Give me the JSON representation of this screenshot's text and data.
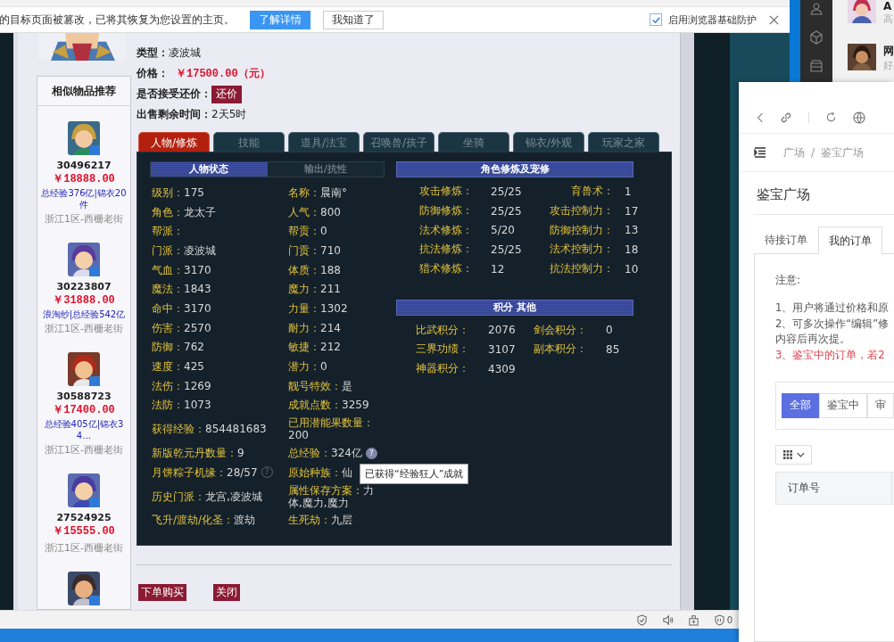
{
  "notification": {
    "message": "的目标页面被篡改，已将其恢复为您设置的主页。",
    "buttons": [
      {
        "label": "了解详情",
        "primary": true
      },
      {
        "label": "我知道了",
        "primary": false
      }
    ],
    "protection": {
      "label": "启用浏览器基础防护",
      "checked": true
    }
  },
  "listing": {
    "fields": [
      {
        "label": "类型：",
        "value": "凌波城",
        "kind": "text"
      },
      {
        "label": "价格：",
        "value": "￥17500.00（元）",
        "kind": "price"
      },
      {
        "label": "是否接受还价：",
        "value": "还价",
        "kind": "button"
      },
      {
        "label": "出售剩余时间：",
        "value": "2天5时",
        "kind": "text"
      }
    ]
  },
  "similar": {
    "title": "相似物品推荐",
    "items": [
      {
        "id": "30496217",
        "price": "￥18888.00",
        "tags": "总经验376亿|锦衣20件",
        "server": "浙江1区-西栅老街"
      },
      {
        "id": "30223807",
        "price": "￥31888.00",
        "tags": "浪淘纱|总经验542亿",
        "server": "浙江1区-西栅老街"
      },
      {
        "id": "30588723",
        "price": "￥17400.00",
        "tags": "总经验405亿|锦衣34…",
        "server": "浙江1区-西栅老街"
      },
      {
        "id": "27524925",
        "price": "￥15555.00",
        "server": "浙江1区-西栅老街"
      }
    ]
  },
  "tabs": [
    {
      "label": "人物/修炼",
      "selected": true
    },
    {
      "label": "技能",
      "selected": false
    },
    {
      "label": "道具/法宝",
      "selected": false
    },
    {
      "label": "召唤兽/孩子",
      "selected": false
    },
    {
      "label": "坐骑",
      "selected": false
    },
    {
      "label": "锦衣/外观",
      "selected": false
    },
    {
      "label": "玩家之家",
      "selected": false
    }
  ],
  "character": {
    "subtabs": [
      {
        "label": "人物状态",
        "selected": true
      },
      {
        "label": "输出/抗性",
        "selected": false
      }
    ],
    "rows": [
      {
        "left": {
          "label": "级别：",
          "value": "175"
        },
        "right": {
          "label": "名称：",
          "value": "晨南°"
        }
      },
      {
        "left": {
          "label": "角色：",
          "value": "龙太子"
        },
        "right": {
          "label": "人气：",
          "value": "800"
        }
      },
      {
        "left": {
          "label": "帮派："
        },
        "right": {
          "label": "帮贡：",
          "value": "0"
        }
      },
      {
        "left": {
          "label": "门派：",
          "value": "凌波城"
        },
        "right": {
          "label": "门贡：",
          "value": "710"
        }
      },
      {
        "left": {
          "label": "气血：",
          "value": "3170"
        },
        "right": {
          "label": "体质：",
          "value": "188"
        }
      },
      {
        "left": {
          "label": "魔法：",
          "value": "1843"
        },
        "right": {
          "label": "魔力：",
          "value": "211"
        }
      },
      {
        "left": {
          "label": "命中：",
          "value": "3170"
        },
        "right": {
          "label": "力量：",
          "value": "1302"
        }
      },
      {
        "left": {
          "label": "伤害：",
          "value": "2570"
        },
        "right": {
          "label": "耐力：",
          "value": "214"
        }
      },
      {
        "left": {
          "label": "防御：",
          "value": "762"
        },
        "right": {
          "label": "敏捷：",
          "value": "212"
        }
      },
      {
        "left": {
          "label": "速度：",
          "value": "425"
        },
        "right": {
          "label": "潜力：",
          "value": "0"
        }
      },
      {
        "left": {
          "label": "法伤：",
          "value": "1269"
        },
        "right": {
          "label": "靓号特效：",
          "value": "是"
        }
      },
      {
        "left": {
          "label": "法防：",
          "value": "1073"
        },
        "right": {
          "label": "成就点数：",
          "value": "3259"
        }
      },
      {
        "left": {
          "label": "获得经验：",
          "value": "854481683"
        },
        "right": {
          "label": "已用潜能果数量：",
          "value": "200"
        }
      },
      {
        "left": {
          "label": "新版乾元丹数量：",
          "value": "9"
        },
        "right": {
          "label": "总经验：",
          "value": "324亿",
          "help": {
            "mark": "?",
            "kind": "filled"
          },
          "tooltip": "已获得“经验狂人”成就"
        }
      },
      {
        "left": {
          "label": "月饼粽子机缘：",
          "value": "28/57",
          "help": {
            "mark": "?",
            "kind": "outline"
          }
        },
        "right": {
          "label": "原始种族：",
          "value": "仙"
        }
      },
      {
        "left": {
          "label": "历史门派：",
          "value": "龙宫,凌波城"
        },
        "right": {
          "label": "属性保存方案：",
          "value": "力体,魔力,魔力"
        }
      },
      {
        "left": {
          "label": "飞升/渡劫/化圣：",
          "value": "渡劫"
        },
        "right": {
          "label": "生死劫：",
          "value": "九层"
        }
      }
    ]
  },
  "cultivation": {
    "title": "角色修炼及宠修",
    "items": [
      {
        "label": "攻击修炼：",
        "value": "25/25"
      },
      {
        "label": "育兽术：",
        "value": "1"
      },
      {
        "label": "防御修炼：",
        "value": "25/25"
      },
      {
        "label": "攻击控制力：",
        "value": "17"
      },
      {
        "label": "法术修炼：",
        "value": "5/20"
      },
      {
        "label": "防御控制力：",
        "value": "13"
      },
      {
        "label": "抗法修炼：",
        "value": "25/25"
      },
      {
        "label": "法术控制力：",
        "value": "18"
      },
      {
        "label": "猎术修炼：",
        "value": "12"
      },
      {
        "label": "抗法控制力：",
        "value": "10"
      }
    ]
  },
  "scores": {
    "title": "积分 其他",
    "items": [
      {
        "label": "比武积分：",
        "value": "2076"
      },
      {
        "label": "剑会积分：",
        "value": "0"
      },
      {
        "label": "三界功绩：",
        "value": "3107"
      },
      {
        "label": "副本积分：",
        "value": "85"
      },
      {
        "label": "神器积分：",
        "value": "4309"
      }
    ]
  },
  "actions": [
    "下单购买",
    "关闭"
  ],
  "status_bar": {
    "badge": "0"
  },
  "dock": {
    "items": [
      {
        "title": "A",
        "subtitle": "高"
      },
      {
        "title": "网",
        "subtitle": "好"
      }
    ]
  },
  "side_window": {
    "breadcrumb": [
      "广场",
      "鉴宝广场"
    ],
    "separator": "/",
    "title": "鉴宝广场",
    "tabs": [
      {
        "label": "待接订单",
        "selected": false
      },
      {
        "label": "我的订单",
        "selected": true
      }
    ],
    "notice_heading": "注意:",
    "notice_lines": [
      {
        "text": "1、用户将通过价格和原",
        "kind": "normal"
      },
      {
        "text": "2、可多次操作“编辑”修",
        "kind": "normal"
      },
      {
        "text": "内容后再次提。",
        "kind": "normal"
      },
      {
        "text": "3、鉴宝中的订单，若2",
        "kind": "warning"
      }
    ],
    "filters": [
      {
        "label": "全部",
        "selected": true
      },
      {
        "label": "鉴宝中",
        "selected": false
      },
      {
        "label": "审",
        "selected": false
      }
    ],
    "columns": [
      "订单号"
    ]
  }
}
